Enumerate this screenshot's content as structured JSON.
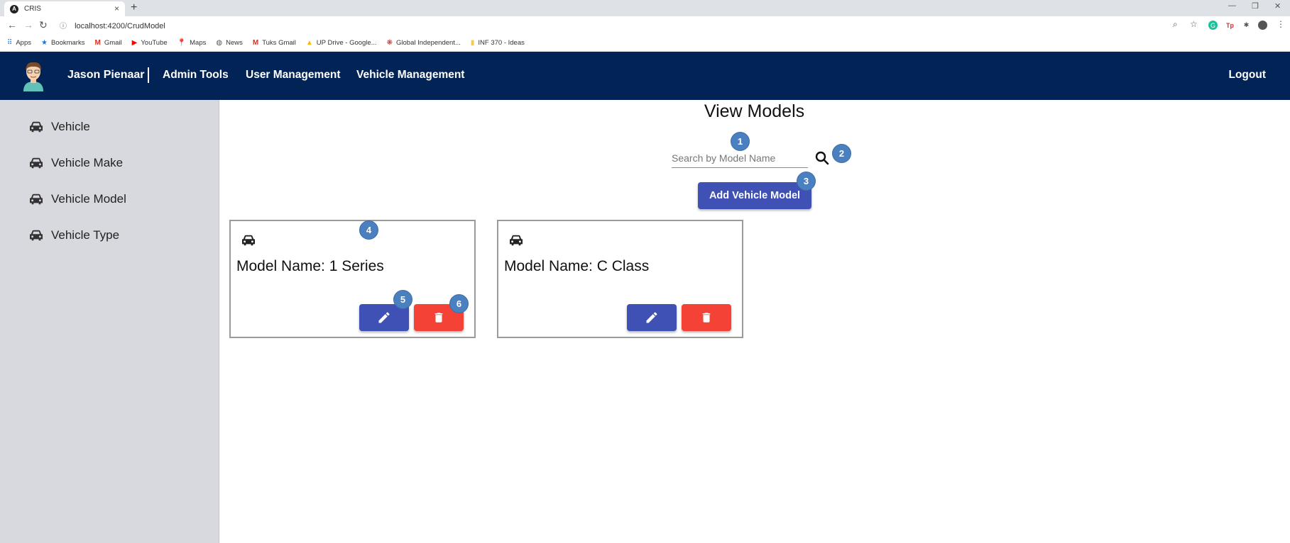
{
  "browser": {
    "tab_title": "CRIS",
    "url": "localhost:4200/CrudModel",
    "bookmarks": [
      "Apps",
      "Bookmarks",
      "Gmail",
      "YouTube",
      "Maps",
      "News",
      "Tuks Gmail",
      "UP Drive - Google...",
      "Global Independent...",
      "INF 370 - Ideas"
    ]
  },
  "header": {
    "user_name": "Jason Pienaar",
    "nav": [
      "Admin Tools",
      "User Management",
      "Vehicle Management"
    ],
    "logout": "Logout"
  },
  "sidebar": {
    "items": [
      {
        "label": "Vehicle",
        "icon": "car-icon"
      },
      {
        "label": "Vehicle Make",
        "icon": "car-icon"
      },
      {
        "label": "Vehicle Model",
        "icon": "car-icon"
      },
      {
        "label": "Vehicle Type",
        "icon": "car-icon"
      }
    ]
  },
  "main": {
    "title": "View Models",
    "search_placeholder": "Search by Model Name",
    "add_button": "Add Vehicle Model",
    "cards": [
      {
        "title": "Model Name: 1 Series"
      },
      {
        "title": "Model Name: C Class"
      }
    ]
  },
  "badges": [
    "1",
    "2",
    "3",
    "4",
    "5",
    "6"
  ],
  "colors": {
    "header_bg": "#012355",
    "sidebar_bg": "#d8d9de",
    "primary": "#3f51b5",
    "danger": "#f44336",
    "badge": "#4a80c0"
  }
}
